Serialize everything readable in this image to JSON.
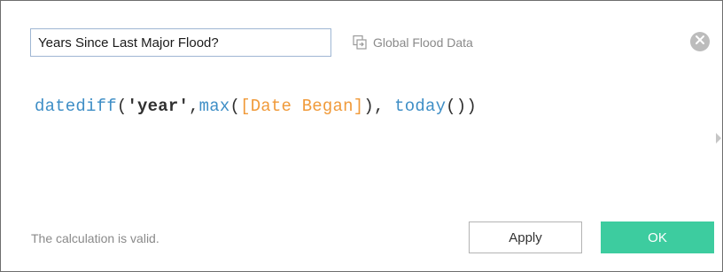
{
  "calc": {
    "name_value": "Years Since Last Major Flood?"
  },
  "data_source": {
    "label": "Global Flood Data",
    "icon": "datasource-icon"
  },
  "formula": {
    "fn_datediff": "datediff",
    "open1": "(",
    "arg_year": "'year'",
    "comma1": ",",
    "fn_max": "max",
    "open2": "(",
    "field": "[Date Began]",
    "close2": ")",
    "comma2": ", ",
    "fn_today": "today",
    "parens": "()",
    "close1": ")"
  },
  "status": {
    "message": "The calculation is valid."
  },
  "buttons": {
    "apply_label": "Apply",
    "ok_label": "OK"
  },
  "colors": {
    "function": "#3e8ec6",
    "field": "#f09a3a",
    "ok_button": "#3dcc9f",
    "close_icon_bg": "#bcbcbc"
  }
}
